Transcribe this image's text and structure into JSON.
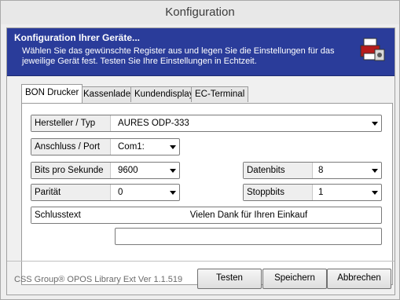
{
  "window": {
    "title": "Konfiguration"
  },
  "header": {
    "title": "Konfiguration Ihrer Geräte...",
    "description": "Wählen Sie das gewünschte Register aus und legen Sie die Einstellungen für das jeweilige Gerät fest. Testen Sie Ihre Einstellungen in Echtzeit.",
    "icon": "printer-settings-icon"
  },
  "tabs": [
    {
      "label": "BON Drucker",
      "active": true
    },
    {
      "label": "Kassenlade",
      "active": false
    },
    {
      "label": "Kundendisplay",
      "active": false
    },
    {
      "label": "EC-Terminal",
      "active": false
    }
  ],
  "form": {
    "hersteller": {
      "label": "Hersteller / Typ",
      "value": "AURES ODP-333"
    },
    "anschluss": {
      "label": "Anschluss / Port",
      "value": "Com1:"
    },
    "bits": {
      "label": "Bits pro Sekunde",
      "value": "9600"
    },
    "datenbits": {
      "label": "Datenbits",
      "value": "8"
    },
    "paritaet": {
      "label": "Parität",
      "value": "0"
    },
    "stoppbits": {
      "label": "Stoppbits",
      "value": "1"
    },
    "schlusstext": {
      "label": "Schlusstext",
      "line1": "Vielen Dank für Ihren Einkauf",
      "line2": ""
    }
  },
  "footer": {
    "version": "CSS Group® OPOS Library Ext Ver 1.1.519",
    "buttons": {
      "test": "Testen",
      "save": "Speichern",
      "cancel": "Abbrechen"
    }
  },
  "colors": {
    "banner": "#2a3c9a",
    "window_bg": "#eeeeee"
  }
}
